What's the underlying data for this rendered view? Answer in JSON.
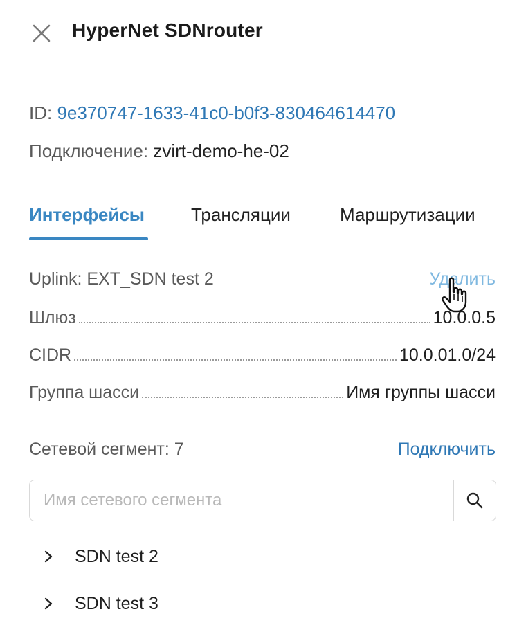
{
  "header": {
    "title": "HyperNet SDNrouter",
    "close_icon": "close-icon"
  },
  "meta": {
    "id_label": "ID:",
    "id_value": "9e370747-1633-41c0-b0f3-830464614470",
    "connection_label": "Подключение:",
    "connection_value": "zvirt-demo-he-02"
  },
  "tabs": [
    {
      "label": "Интерфейсы",
      "active": true
    },
    {
      "label": "Трансляции",
      "active": false
    },
    {
      "label": "Маршрутизации",
      "active": false
    }
  ],
  "uplink": {
    "title": "Uplink: EXT_SDN test 2",
    "delete_label": "Удалить",
    "rows": [
      {
        "label": "Шлюз",
        "value": "10.0.0.5"
      },
      {
        "label": "CIDR",
        "value": "10.0.01.0/24"
      },
      {
        "label": "Группа шасси",
        "value": "Имя группы шасси"
      }
    ]
  },
  "segment": {
    "title": "Сетевой сегмент: 7",
    "connect_label": "Подключить",
    "search_placeholder": "Имя сетевого сегмента",
    "items": [
      {
        "label": "SDN test 2"
      },
      {
        "label": "SDN test 3"
      }
    ]
  },
  "colors": {
    "accent": "#3a87c2",
    "link": "#2f78b5",
    "link_hover": "#7fb8e0",
    "muted_text": "#5a5a5a"
  }
}
